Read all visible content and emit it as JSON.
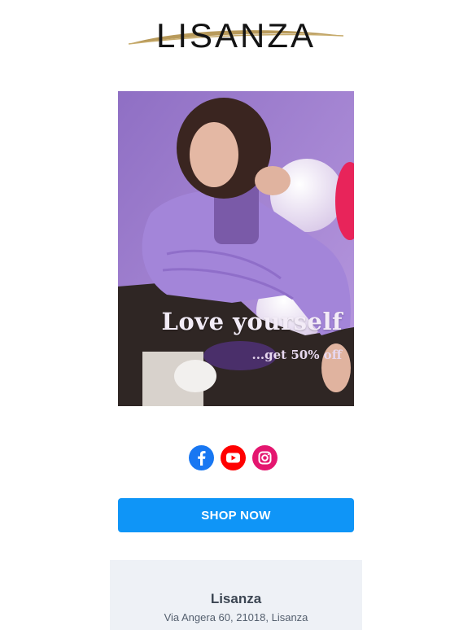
{
  "brand": {
    "logo_text": "LISANZA",
    "swoosh_color": "#b89a5a"
  },
  "hero": {
    "headline": "Love yourself",
    "subline": "...get 50% off",
    "background": "#9a78c9"
  },
  "social": [
    {
      "icon": "facebook-icon",
      "color": "#1877f2"
    },
    {
      "icon": "youtube-icon",
      "color": "#ff0000"
    },
    {
      "icon": "instagram-icon",
      "color": "#e4166f"
    }
  ],
  "cta": {
    "label": "SHOP NOW",
    "color": "#0f95f7"
  },
  "footer": {
    "name": "Lisanza",
    "address": "Via Angera 60, 21018, Lisanza"
  }
}
